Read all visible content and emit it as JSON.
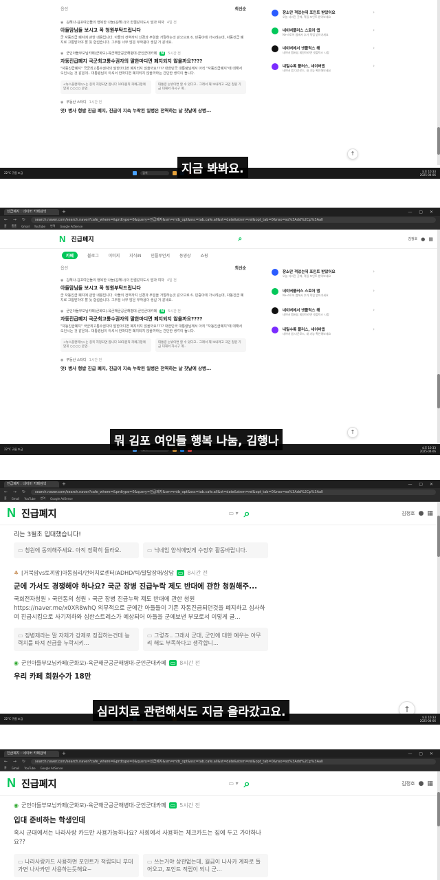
{
  "browser": {
    "tab_title": "진급폐지 : 네이버 카페검색",
    "url": "search.naver.com/search.naver?cafe_where=&prdtype=0&query=진급폐지&sm=mtb_opt&ssc=tab.cafe.all&st=date&stnm=rel&opt_tab=0&nso=so%3Add%2Cp%3Aall",
    "bookmarks": [
      "홈",
      "홈홈",
      "홈",
      "홈",
      "Gmail",
      "홈",
      "YouTube",
      "홈",
      "홈",
      "홈",
      "번역",
      "홈",
      "홈",
      "Google AdSense",
      "홈"
    ]
  },
  "naver": {
    "logo": "N",
    "query": "진급폐지",
    "search_icon": "search-icon",
    "user": "김정호",
    "tabs": [
      "카페",
      "블로그",
      "이미지",
      "지식iN",
      "인플루언서",
      "동영상",
      "쇼핑"
    ],
    "sort": "최신순",
    "filter": "옵션"
  },
  "results": {
    "r1_cafe": "김해나-김포여인들의 행복한 나눔(김해나)의 한결같이도시 맘과 여자",
    "r1_time": "4일 전",
    "r1_title": "아들맘님들 보시고 꼭 청원부탁드립니다",
    "r1_desc": "군 자동진급 폐지에 관한 내용입니다. 아들의 전역까지 신경과 무임을 거절하는것 같으므로 6. 민증이에 가시려는대, 자동진급 폐지로 고통받아야 할 듯 합섭습니다. 그부분 너무 많은 부작용이 생길 거 같네요.",
    "r2_cafe": "군인아들부모님카페(군화모)-육군해군공군해병대-군인군대카페",
    "r2_time": "5시간 전",
    "r2_title": "자동진급폐지 국군최고통수권자의 말한마디면 폐지되지 않을까요????",
    "r2_desc": "\"자동진급폐지\" 국군최고통수권자의 말한마디면 폐지되지 않을까요???? 대한민국 대통령님께서 아직 \"자동진급폐지\"에 대해서 오인시는 것 같은데.. 대통령님이 아셔서 한마디면 폐지되지 않을까하는 간단한 생각이 듭니다.",
    "r2_c1": "&lt;뉴스플랜미뉴&gt;는 종목 지정되면 합니다 10대원칙 카페규정에 맞게 ○○○○ 운영..",
    "r2_c2": "대통령 눈밖이면 할 수 있다고.. 그래서 재 보내려고 국민 청원 기금 대해서 하시구 계..",
    "r3_cafe": "부동산 스터디",
    "r3_time": "1시간 전",
    "r3_title": "엇! 병사 헝밥 진급 폐지, 진급이 지속 누락된 일병은 전역하는 날 찻날에 상병...",
    "r4_cafe": "[거북맘vs토끼맘]아동심리/언어치료센터/ADHD/틱/발달장애/상담",
    "r4_time": "8시간 전",
    "r4_pre": "리는 3월초 입대했습니다!",
    "r4_c_pre1": "청원에 동의해주세요. 아직 정확히 들라요.",
    "r4_c_pre2": "닉네임 양식에맞게 수정후 활동바랍니다.",
    "r4_title": "군에 가서도 경쟁해야 하나요? 국군 장병 진급누락 제도 반대에 관한 청원해주...",
    "r4_desc": "국회전자청원 › 국민동의 청원 › 국군 장병 진급누락 제도 반대에 관한 청원 https://naver.me/x0XR8whQ 의무적으로 군에간 아들들이 기존 자동진급되던것을 폐지하고 심사하여 진급시킴으로 사기저하와 심한스트레스가 예상되어 아들을 군에보낸 부모로서 이렇게 글...",
    "r4_c1": "징병제라는 말 자체가 강제로 징집하는건데 능력치를 따져 진급을 누락시키...",
    "r4_c2": "그렇죠.. 그래서 군대, 군인에 대한 예우는 아무리 해도 부족하다고 생각합니...",
    "r5_cafe": "군인아들부모님카페(군화모)-육군해군공군해병대-군인군대카페",
    "r5_time": "8시간 전",
    "r5_title": "우리 카페 회원수가 18만",
    "r6_cafe": "군인아들부모님카페(군화모)-육군해군공군해병대-군인군대카페",
    "r6_time": "5시간 전",
    "r6_title": "입대 준비하는 학생인데",
    "r6_desc": "혹시 군대에서는 나라사랑 카드만 사용가능하나요? 사회에서 사용하는 체크카드는 집에 두고 가야하나요??",
    "r6_c1": "나라사랑카드 사용하면 포인트가 적립되니 부대가면 나사카만 사용하는듯해요~",
    "r6_c2": "쓰는거야 상관없는데, 월급이 나사카 계좌로 들어오고, 포인트 적립이 되니 군..."
  },
  "sidebar": [
    {
      "title": "장소만 적었는데 포인트 받았어요",
      "sub": "오늘 다녀간 곳에, 적립 포인트 받아보세요",
      "color": "#2b5cff"
    },
    {
      "title": "네이버플러스 스토어 앱",
      "sub": "N+스토어 앱에서 추가 적립 받아가세요",
      "color": "#03c75a"
    },
    {
      "title": "네이버에서 넷플릭스 해",
      "sub": "네이버 멤버십 회원이라면 넷플릭스 시청",
      "color": "#111111"
    },
    {
      "title": "내일수록 플러스, 네이버앱",
      "sub": "네이버 앱 다운로드, 새 기능 확인해보세요",
      "color": "#7b2cff"
    }
  ],
  "captions": {
    "c1": "지금 봐봐요.",
    "c2": "뭐 김포 여인들 행복 나눔, 김행나",
    "c3": "심리치료 관련해서도 지금 올라갔고요."
  },
  "taskbar": {
    "weather": "22°C 구름 조금",
    "search": "검색",
    "clock": "오후 10:33",
    "date": "2025-04-06"
  },
  "ui": {
    "up_arrow": "↑",
    "chevron": "›",
    "comment_icon": "▭"
  }
}
